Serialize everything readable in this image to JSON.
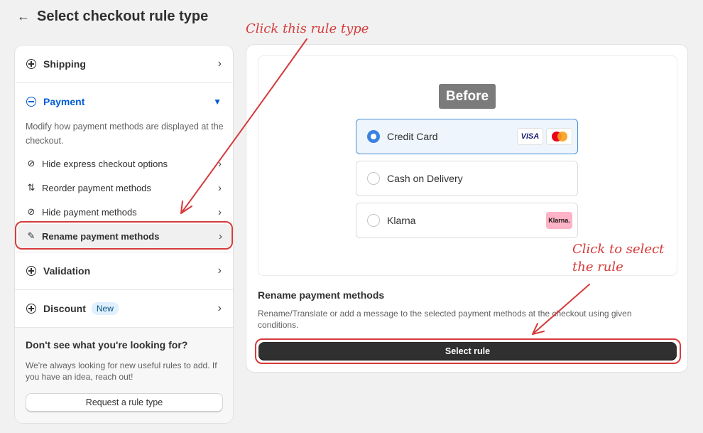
{
  "header": {
    "back_glyph": "←",
    "title": "Select checkout rule type"
  },
  "sidebar": {
    "sections": [
      {
        "label": "Shipping",
        "icon": "plus-circle-icon"
      },
      {
        "label": "Payment",
        "icon": "minus-circle-icon"
      },
      {
        "label": "Validation",
        "icon": "plus-circle-icon"
      },
      {
        "label": "Discount",
        "icon": "plus-circle-icon",
        "badge": "New"
      }
    ],
    "payment_description": "Modify how payment methods are displayed at the checkout.",
    "payment_items": [
      {
        "label": "Hide express checkout options",
        "icon": "eye-slash-icon"
      },
      {
        "label": "Reorder payment methods",
        "icon": "arrows-up-down-icon"
      },
      {
        "label": "Hide payment methods",
        "icon": "eye-slash-icon"
      },
      {
        "label": "Rename payment methods",
        "icon": "pencil-icon"
      }
    ],
    "footer": {
      "title": "Don't see what you're looking for?",
      "text": "We're always looking for new useful rules to add. If you have an idea, reach out!",
      "button_label": "Request a rule type"
    }
  },
  "preview": {
    "tag": "Before",
    "options": [
      {
        "label": "Credit Card",
        "selected": true,
        "logos": [
          "VISA",
          "mastercard"
        ]
      },
      {
        "label": "Cash on Delivery",
        "selected": false
      },
      {
        "label": "Klarna",
        "selected": false,
        "logos": [
          "Klarna."
        ]
      }
    ]
  },
  "rule": {
    "title": "Rename payment methods",
    "description": "Rename/Translate or add a message to the selected payment methods at the checkout using given conditions.",
    "button_label": "Select rule"
  },
  "annotations": {
    "click_rule_type": "Click this rule type",
    "click_select_line1": "Click to select",
    "click_select_line2": "the rule"
  },
  "colors": {
    "accent": "#005bd3",
    "annotation": "#d63b3b",
    "primary_button": "#303030",
    "selected_option_bg": "#eef5fd"
  }
}
